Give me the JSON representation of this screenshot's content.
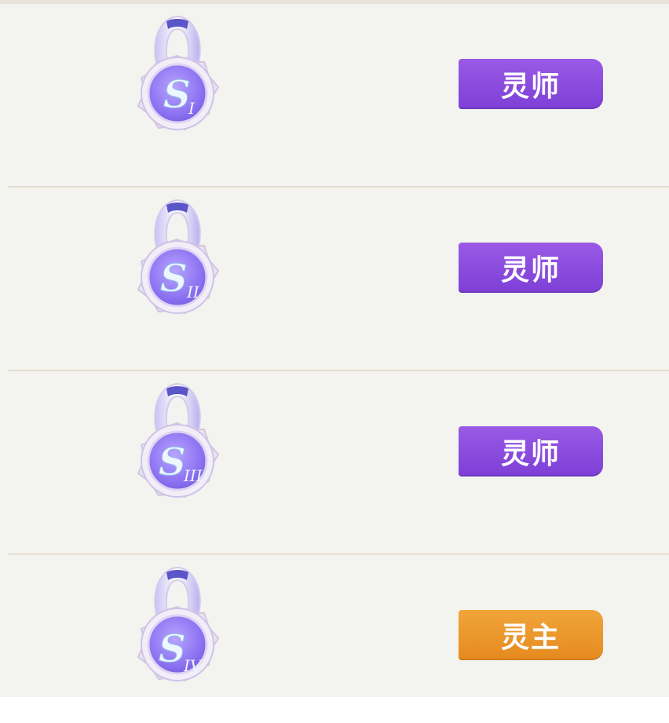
{
  "rows": [
    {
      "rank_numeral": "I",
      "title": "灵师",
      "badge_color": "#8a4ade"
    },
    {
      "rank_numeral": "II",
      "title": "灵师",
      "badge_color": "#8a4ade"
    },
    {
      "rank_numeral": "III",
      "title": "灵师",
      "badge_color": "#8a4ade"
    },
    {
      "rank_numeral": "IV",
      "title": "灵主",
      "badge_color": "#eb972b"
    }
  ],
  "medal_letter": "S",
  "colors": {
    "panel_bg": "#f3f3ef",
    "separator": "#e7ded0",
    "ribbon": "#6a5bd0",
    "medal_core": "#8b6ff0"
  }
}
